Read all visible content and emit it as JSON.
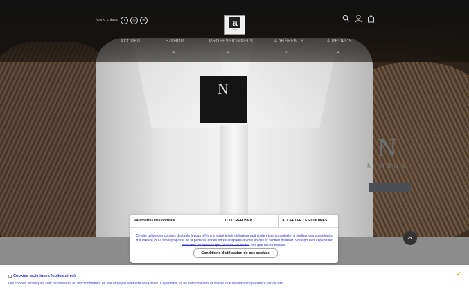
{
  "header": {
    "follow_text": "Nous suivre",
    "social": [
      {
        "icon": "facebook-icon",
        "glyph": "f"
      },
      {
        "icon": "instagram-icon",
        "glyph": "◎"
      },
      {
        "icon": "linkedin-icon",
        "glyph": "in"
      }
    ],
    "logo_letter": "a",
    "logo_sub": "dalas",
    "icons": [
      "search-icon",
      "user-icon",
      "cart-icon"
    ]
  },
  "nav": {
    "items": [
      "ACCUEIL",
      "E-SHOP",
      "PROFESSIONNELS",
      "ADHÉRENTS",
      "À PROPOS"
    ],
    "chevron": "⌄"
  },
  "hero": {
    "label_letter": "N",
    "brand_letter": "N",
    "brand_word": "NIMBUS"
  },
  "modal": {
    "title": "Paramètres des cookies",
    "reject": "TOUT REFUSER",
    "accept": "ACCEPTER LES COOKIES",
    "text_main": "Ce site utilise des cookies destinés à vous offrir une expérience utilisateur optimisée et personnalisée, à réaliser des statistiques d'audience, ou à vous proposer de la publicité et des offres adaptées à vous envies et centres d'intérêt. Vous pouvez cependant",
    "text_strike": "décocher les cookies que vous ne souhaitez",
    "text_end": "pas que nous utilisions.",
    "conditions": "Conditions d'utilisation de ces cookies"
  },
  "bottom_panel": {
    "title": "Cookies techniques (obligatoires)",
    "text": "Les cookies techniques sont nécessaires au fonctionnement de site et ne peuvent être désactivés. Cependant, ils ne sont collectés et utilisés que durant votre présence sur ce site."
  },
  "colors": {
    "link_blue": "#2a2ad0",
    "dark_bg": "#221a14"
  }
}
